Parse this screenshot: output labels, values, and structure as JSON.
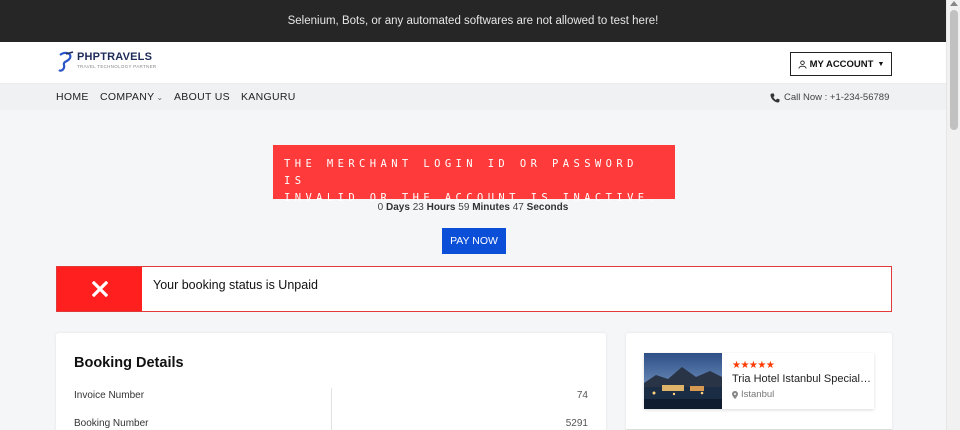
{
  "topbar": {
    "message": "Selenium, Bots, or any automated softwares are not allowed to test here!"
  },
  "header": {
    "logo_name": "PHPTRAVELS",
    "logo_tagline": "TRAVEL TECHNOLOGY PARTNER",
    "account_label": "MY ACCOUNT",
    "account_icon": "user-icon"
  },
  "nav": {
    "items": [
      {
        "label": "HOME"
      },
      {
        "label": "COMPANY"
      },
      {
        "label": "ABOUT US"
      },
      {
        "label": "KANGURU"
      }
    ],
    "call_label": "Call Now : +1-234-56789"
  },
  "alert": {
    "line1": "THE MERCHANT LOGIN ID OR PASSWORD IS",
    "line2": "INVALID OR THE ACCOUNT IS INACTIVE.",
    "color": "#ff3a3a"
  },
  "countdown": {
    "days_value": "0",
    "days_label": "Days",
    "hours_value": "23",
    "hours_label": "Hours",
    "minutes_value": "59",
    "minutes_label": "Minutes",
    "seconds_value": "47",
    "seconds_label": "Seconds"
  },
  "pay_button": {
    "label": "PAY NOW",
    "color": "#0b4fd9"
  },
  "status": {
    "text": "Your booking status is Unpaid",
    "color": "#ff1f1f"
  },
  "booking_details": {
    "title": "Booking Details",
    "rows": [
      {
        "label": "Invoice Number",
        "value": "74"
      },
      {
        "label": "Booking Number",
        "value": "5291"
      }
    ]
  },
  "hotel": {
    "stars": "★★★★★",
    "name": "Tria Hotel Istanbul Special Class",
    "location": "Istanbul"
  }
}
